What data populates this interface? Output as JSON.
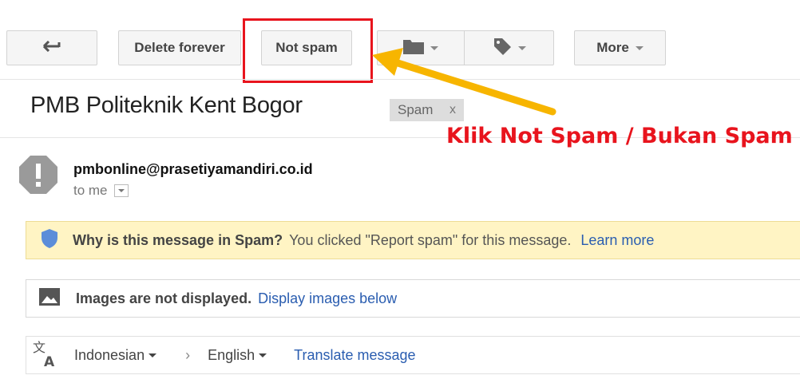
{
  "toolbar": {
    "back_icon": "back-arrow-icon",
    "delete_label": "Delete forever",
    "not_spam_label": "Not spam",
    "move_icon": "folder-icon",
    "labels_icon": "tag-icon",
    "more_label": "More"
  },
  "message": {
    "subject": "PMB Politeknik Kent Bogor",
    "tag_label": "Spam",
    "tag_remove": "x",
    "sender": "pmbonline@prasetiyamandiri.co.id",
    "recipient_label": "to me"
  },
  "annotation": {
    "text": "Klik Not Spam / Bukan Spam",
    "color": "#e8141d",
    "arrow_color": "#f7b500"
  },
  "spam_banner": {
    "title": "Why is this message in Spam?",
    "reason": "You clicked \"Report spam\" for this message.",
    "link": "Learn more"
  },
  "images_banner": {
    "title": "Images are not displayed.",
    "link": "Display images below"
  },
  "translate_bar": {
    "from_lang": "Indonesian",
    "to_lang": "English",
    "link": "Translate message"
  }
}
